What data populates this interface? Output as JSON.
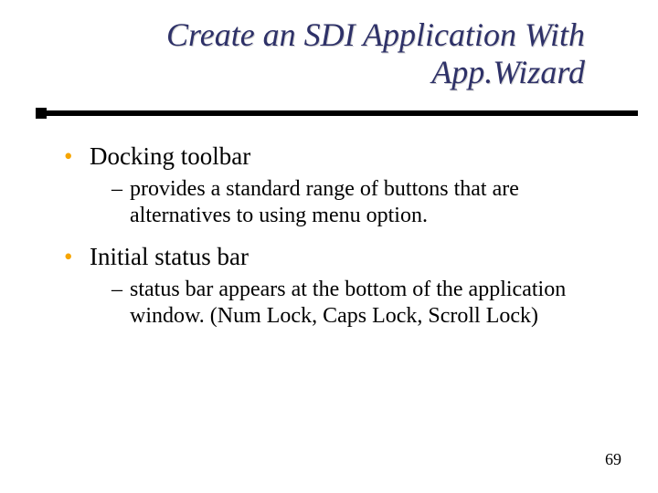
{
  "title_line1": "Create an SDI Application With",
  "title_line2": "App.Wizard",
  "bullets": [
    {
      "label": "Docking toolbar",
      "sub": "provides a standard range of buttons that are alternatives to using menu option."
    },
    {
      "label": "Initial status bar",
      "sub": "status bar appears at the bottom of the application window.  (Num Lock, Caps Lock, Scroll Lock)"
    }
  ],
  "page_number": "69"
}
